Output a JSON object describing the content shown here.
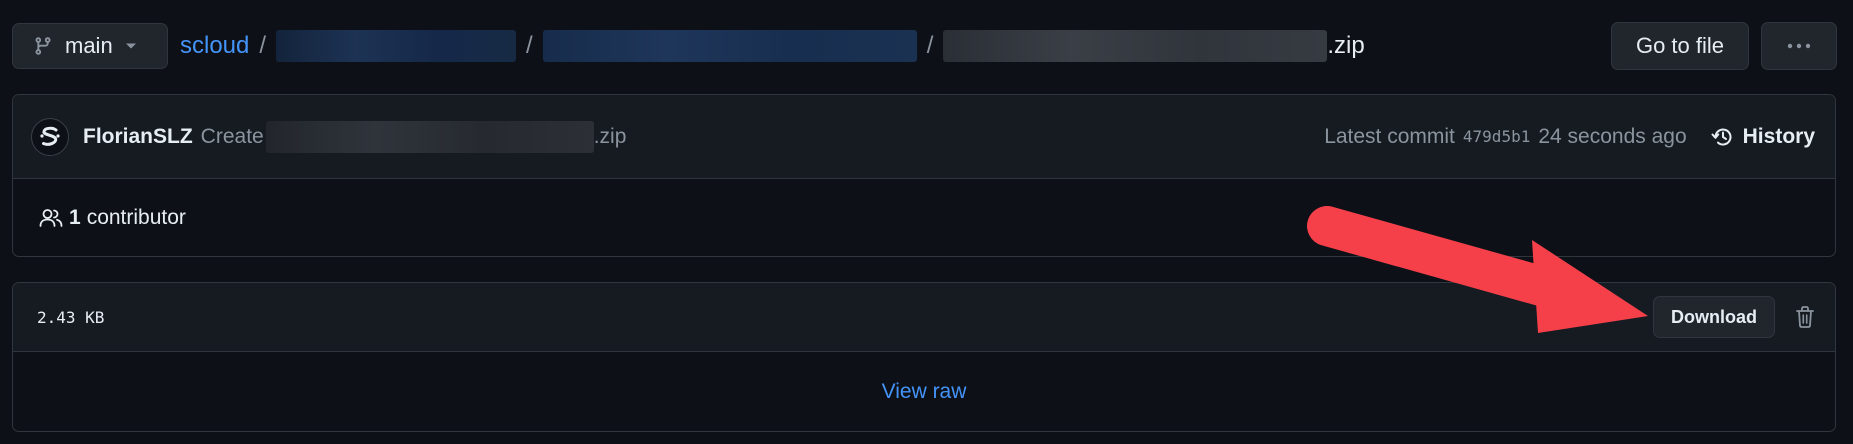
{
  "branch": {
    "name": "main"
  },
  "breadcrumb": {
    "repo": "scloud",
    "separator": "/",
    "file_suffix": ".zip"
  },
  "toolbar": {
    "go_to_file": "Go to file",
    "more": "···"
  },
  "commit": {
    "author": "FlorianSLZ",
    "message_prefix": "Create",
    "message_suffix": ".zip",
    "latest_label": "Latest commit",
    "sha": "479d5b1",
    "time_ago": "24 seconds ago",
    "history_label": "History"
  },
  "contributors": {
    "count": "1",
    "label": "contributor"
  },
  "file": {
    "size": "2.43 KB",
    "download_label": "Download",
    "view_raw": "View raw"
  },
  "colors": {
    "link": "#4493f8",
    "background": "#0d1117",
    "annotation_arrow": "#f5404a"
  }
}
